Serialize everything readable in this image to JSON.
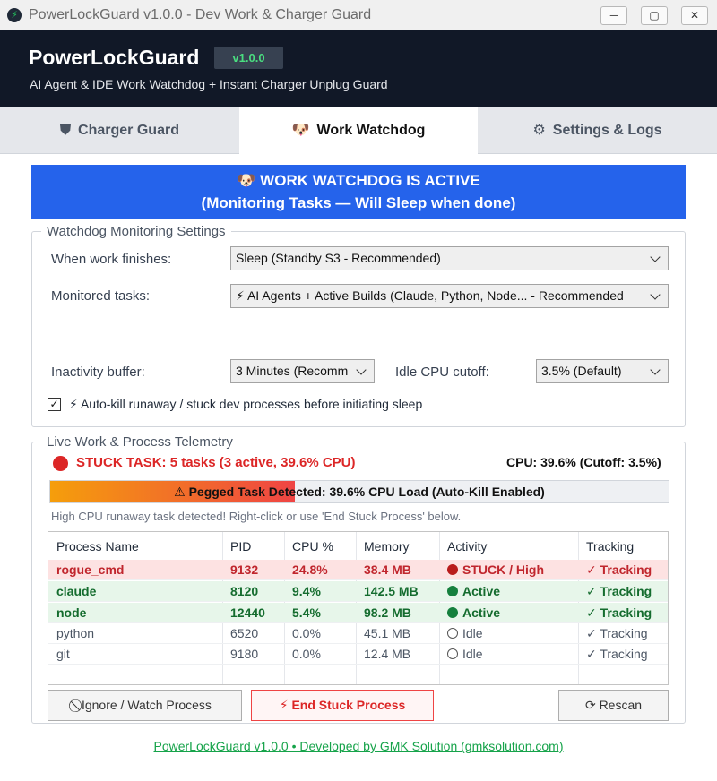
{
  "window": {
    "title": "PowerLockGuard v1.0.0 - Dev Work & Charger Guard",
    "app_icon": "bolt-icon",
    "minimize_glyph": "─",
    "maximize_glyph": "▢",
    "close_glyph": "✕"
  },
  "header": {
    "app_name": "PowerLockGuard",
    "version": "v1.0.0",
    "subtitle": "AI Agent & IDE Work Watchdog + Instant Charger Unplug Guard"
  },
  "tabs": [
    {
      "label": "Charger Guard",
      "icon": "shield-icon",
      "glyph": "⛊",
      "active": false
    },
    {
      "label": "Work Watchdog",
      "icon": "dog-face-icon",
      "glyph": "🐶",
      "active": true
    },
    {
      "label": "Settings & Logs",
      "icon": "gear-icon",
      "glyph": "⚙",
      "active": false
    }
  ],
  "status_banner": {
    "icon": "dog-face-icon",
    "line1": "🐶 WORK WATCHDOG IS ACTIVE",
    "line2": "(Monitoring Tasks — Will Sleep when done)",
    "color": "#2563eb"
  },
  "settings": {
    "legend": "Watchdog Monitoring Settings",
    "when_finish_label": "When work finishes:",
    "when_finish_value": "Sleep (Standby S3 - Recommended)",
    "monitored_label": "Monitored tasks:",
    "monitored_value": "⚡ AI Agents + Active Builds (Claude, Python, Node... - Recommended",
    "inactivity_label": "Inactivity buffer:",
    "inactivity_value": "3 Minutes (Recomm",
    "idle_cpu_label": "Idle CPU cutoff:",
    "idle_cpu_value": "3.5% (Default)",
    "autokill_checked": true,
    "autokill_check_glyph": "✓",
    "autokill_label": "⚡ Auto-kill runaway / stuck dev processes before initiating sleep"
  },
  "telemetry": {
    "legend": "Live Work & Process Telemetry",
    "stuck_text": "STUCK TASK: 5 tasks (3 active, 39.6% CPU)",
    "cpu_text": "CPU: 39.6% (Cutoff: 3.5%)",
    "progress_fraction": 0.396,
    "progress_text": "⚠ Pegged Task Detected: 39.6% CPU Load (Auto-Kill Enabled)",
    "hint": "High CPU runaway task detected! Right-click or use 'End Stuck Process' below.",
    "columns": [
      "Process Name",
      "PID",
      "CPU %",
      "Memory",
      "Activity",
      "Tracking"
    ],
    "rows": [
      {
        "status": "stuck",
        "name": "rogue_cmd",
        "pid": "9132",
        "cpu": "24.8%",
        "memory": "38.4 MB",
        "activity": "STUCK / High",
        "tracking": "✓ Tracking"
      },
      {
        "status": "active",
        "name": "claude",
        "pid": "8120",
        "cpu": "9.4%",
        "memory": "142.5 MB",
        "activity": "Active",
        "tracking": "✓ Tracking"
      },
      {
        "status": "active",
        "name": "node",
        "pid": "12440",
        "cpu": "5.4%",
        "memory": "98.2 MB",
        "activity": "Active",
        "tracking": "✓ Tracking"
      },
      {
        "status": "idle",
        "name": "python",
        "pid": "6520",
        "cpu": "0.0%",
        "memory": "45.1 MB",
        "activity": "Idle",
        "tracking": "✓ Tracking"
      },
      {
        "status": "idle",
        "name": "git",
        "pid": "9180",
        "cpu": "0.0%",
        "memory": "12.4 MB",
        "activity": "Idle",
        "tracking": "✓ Tracking"
      }
    ]
  },
  "buttons": {
    "ignore": "⃠ Ignore / Watch Process",
    "end_stuck": "⚡ End Stuck Process",
    "rescan": "⟳ Rescan"
  },
  "footer": {
    "link_text": "PowerLockGuard v1.0.0 • Developed by GMK Solution (gmksolution.com)"
  },
  "colors": {
    "accent_blue": "#2563eb",
    "danger_red": "#dc2626",
    "success_green": "#16a34a",
    "banner_dark": "#111827"
  }
}
